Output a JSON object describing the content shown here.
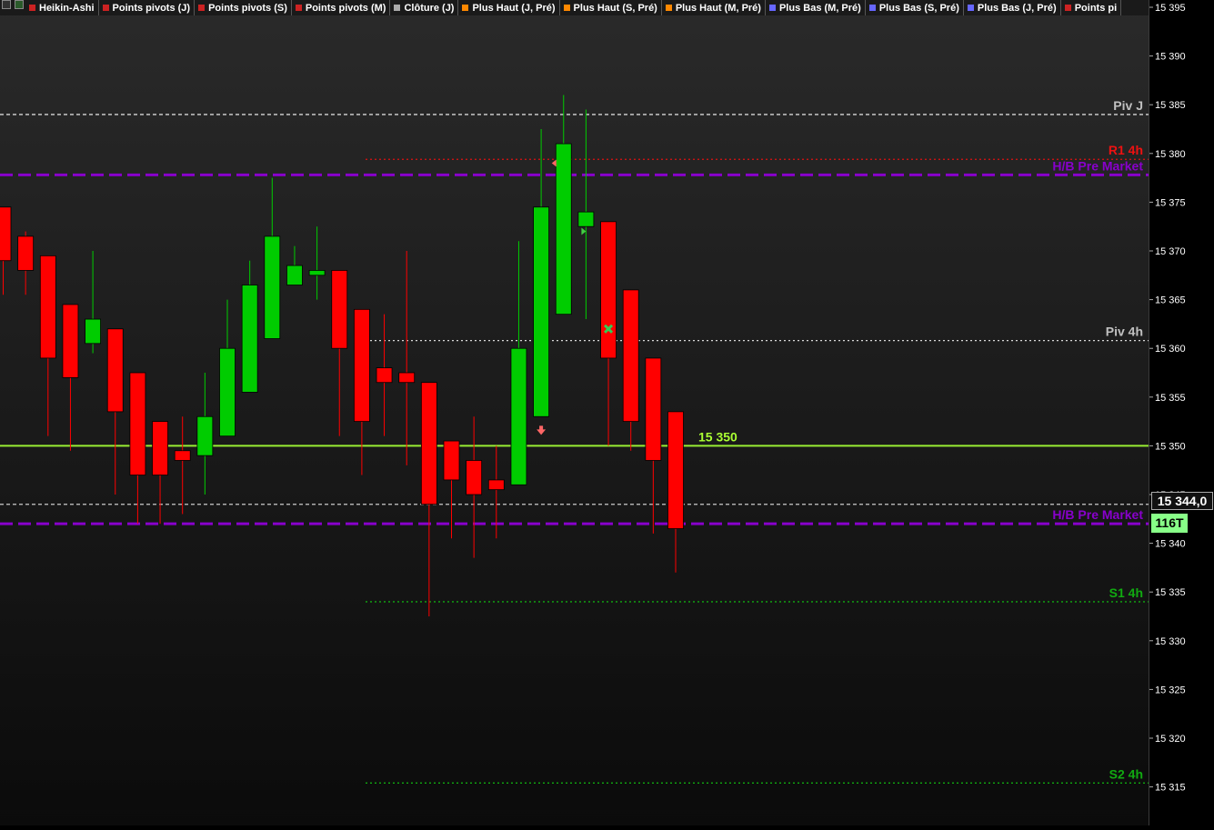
{
  "toolbar": {
    "items": [
      {
        "label": "Heikin-Ashi",
        "color": "#cc2222"
      },
      {
        "label": "Points pivots (J)",
        "color": "#cc2222"
      },
      {
        "label": "Points pivots (S)",
        "color": "#cc2222"
      },
      {
        "label": "Points pivots (M)",
        "color": "#cc2222"
      },
      {
        "label": "Clôture (J)",
        "color": "#aaaaaa"
      },
      {
        "label": "Plus Haut (J, Pré)",
        "color": "#ff8800"
      },
      {
        "label": "Plus Haut (S, Pré)",
        "color": "#ff8800"
      },
      {
        "label": "Plus Haut (M, Pré)",
        "color": "#ff8800"
      },
      {
        "label": "Plus Bas (M, Pré)",
        "color": "#6666ff"
      },
      {
        "label": "Plus Bas (S, Pré)",
        "color": "#6666ff"
      },
      {
        "label": "Plus Bas (J, Pré)",
        "color": "#6666ff"
      },
      {
        "label": "Points pi",
        "color": "#cc2222"
      }
    ],
    "icons": [
      "chart-settings-icon",
      "chart-type-icon"
    ]
  },
  "price_box": {
    "value": "15 344,0",
    "volume": "116T"
  },
  "chart_data": {
    "type": "candlestick",
    "y_axis": {
      "ticks": [
        15395,
        15390,
        15385,
        15380,
        15375,
        15370,
        15365,
        15360,
        15355,
        15350,
        15345,
        15340,
        15335,
        15330,
        15325,
        15320,
        15315
      ],
      "tick_labels": [
        "15 395",
        "15 390",
        "15 385",
        "15 380",
        "15 375",
        "15 370",
        "15 365",
        "15 360",
        "15 355",
        "15 350",
        "15 345",
        "15 340",
        "15 335",
        "15 330",
        "15 325",
        "15 320",
        "15 315"
      ],
      "ylim": [
        15311,
        15396
      ]
    },
    "candles": [
      {
        "o": 15374.5,
        "h": 15374.5,
        "l": 15365.5,
        "c": 15369
      },
      {
        "o": 15371.5,
        "h": 15372,
        "l": 15365.5,
        "c": 15368
      },
      {
        "o": 15369.5,
        "h": 15369.5,
        "l": 15351,
        "c": 15359
      },
      {
        "o": 15364.5,
        "h": 15364.5,
        "l": 15349.5,
        "c": 15357
      },
      {
        "o": 15360.5,
        "h": 15370,
        "l": 15359.5,
        "c": 15363
      },
      {
        "o": 15362,
        "h": 15362,
        "l": 15345,
        "c": 15353.5
      },
      {
        "o": 15357.5,
        "h": 15357.5,
        "l": 15342,
        "c": 15347
      },
      {
        "o": 15352.5,
        "h": 15352.5,
        "l": 15342,
        "c": 15347
      },
      {
        "o": 15349.5,
        "h": 15353,
        "l": 15343,
        "c": 15348.5
      },
      {
        "o": 15349,
        "h": 15357.5,
        "l": 15345,
        "c": 15353
      },
      {
        "o": 15351,
        "h": 15365,
        "l": 15351,
        "c": 15360
      },
      {
        "o": 15355.5,
        "h": 15369,
        "l": 15355.5,
        "c": 15366.5
      },
      {
        "o": 15361,
        "h": 15377.5,
        "l": 15361,
        "c": 15371.5
      },
      {
        "o": 15366.5,
        "h": 15370.5,
        "l": 15366.5,
        "c": 15368.5
      },
      {
        "o": 15367.5,
        "h": 15372.5,
        "l": 15365,
        "c": 15368
      },
      {
        "o": 15368,
        "h": 15368,
        "l": 15351,
        "c": 15360
      },
      {
        "o": 15364,
        "h": 15364,
        "l": 15347,
        "c": 15352.5
      },
      {
        "o": 15358,
        "h": 15363.5,
        "l": 15351,
        "c": 15356.5
      },
      {
        "o": 15357.5,
        "h": 15370,
        "l": 15348,
        "c": 15356.5
      },
      {
        "o": 15356.5,
        "h": 15356.5,
        "l": 15332.5,
        "c": 15344
      },
      {
        "o": 15350.5,
        "h": 15350.5,
        "l": 15340.5,
        "c": 15346.5
      },
      {
        "o": 15348.5,
        "h": 15353,
        "l": 15338.5,
        "c": 15345
      },
      {
        "o": 15346.5,
        "h": 15350,
        "l": 15340.5,
        "c": 15345.5
      },
      {
        "o": 15346,
        "h": 15371,
        "l": 15346,
        "c": 15360
      },
      {
        "o": 15353,
        "h": 15382.5,
        "l": 15353,
        "c": 15374.5
      },
      {
        "o": 15363.5,
        "h": 15386,
        "l": 15363.5,
        "c": 15381
      },
      {
        "o": 15372.5,
        "h": 15384.5,
        "l": 15363,
        "c": 15374
      },
      {
        "o": 15373,
        "h": 15373,
        "l": 15350,
        "c": 15359
      },
      {
        "o": 15366,
        "h": 15366,
        "l": 15349.5,
        "c": 15352.5
      },
      {
        "o": 15359,
        "h": 15359,
        "l": 15341,
        "c": 15348.5
      },
      {
        "o": 15353.5,
        "h": 15353.5,
        "l": 15337,
        "c": 15341.5
      }
    ],
    "levels": [
      {
        "label": "Piv J",
        "value": 15384,
        "color": "#d8d8d8",
        "label_color": "#c0c0c0",
        "style": "dashed-short",
        "from_left": true
      },
      {
        "label": "R1 4h",
        "value": 15379.4,
        "color": "#dd1111",
        "label_color": "#ee1111",
        "style": "dotted",
        "from_left": false
      },
      {
        "label": "H/B Pre Market",
        "value": 15377.8,
        "color": "#8800cc",
        "label_color": "#8800cc",
        "style": "dashed-long",
        "from_left": true
      },
      {
        "label": "Piv 4h",
        "value": 15360.8,
        "color": "#d8d8d8",
        "label_color": "#c0c0c0",
        "style": "dotted",
        "from_left": false
      },
      {
        "label": "15 350",
        "value": 15350,
        "color": "#99ee33",
        "label_color": "#aaff33",
        "style": "solid",
        "from_left": true,
        "label_pos": "mid"
      },
      {
        "label": "",
        "value": 15344,
        "color": "#cccccc",
        "label_color": "#cccccc",
        "style": "dashed-short",
        "from_left": true
      },
      {
        "label": "H/B Pre Market",
        "value": 15342,
        "color": "#8800cc",
        "label_color": "#8800cc",
        "style": "dashed-long",
        "from_left": true
      },
      {
        "label": "S1 4h",
        "value": 15334,
        "color": "#11aa11",
        "label_color": "#11aa11",
        "style": "dotted",
        "from_left": false
      },
      {
        "label": "S2 4h",
        "value": 15315.4,
        "color": "#11aa11",
        "label_color": "#11aa11",
        "style": "dotted",
        "from_left": false
      }
    ],
    "markers": [
      {
        "type": "arrow-down",
        "candle": 24,
        "value": 15351.5,
        "color": "#ff6666"
      },
      {
        "type": "triangle-left",
        "candle": 25,
        "value": 15379,
        "color": "#ff6666"
      },
      {
        "type": "triangle-right",
        "candle": 26,
        "value": 15372,
        "color": "#44cc44"
      },
      {
        "type": "cross",
        "candle": 27,
        "value": 15362,
        "color": "#33cc55"
      }
    ],
    "up_color": "#00cc00",
    "down_color": "#ff0000"
  }
}
